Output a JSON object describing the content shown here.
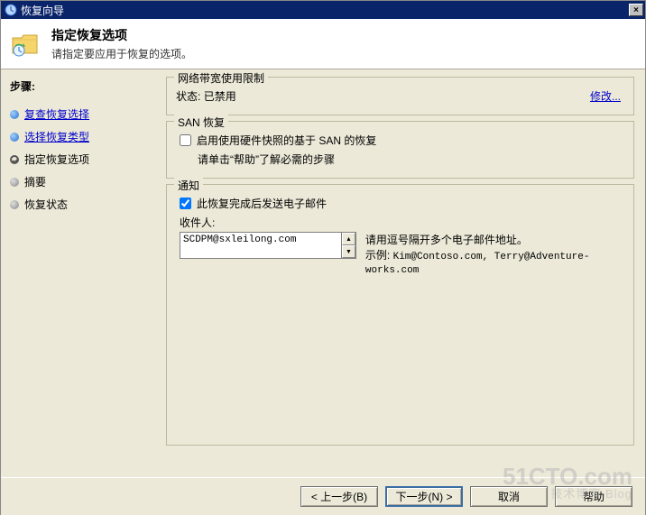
{
  "window": {
    "title": "恢复向导",
    "close": "×"
  },
  "header": {
    "title": "指定恢复选项",
    "subtitle": "请指定要应用于恢复的选项。"
  },
  "sidebar": {
    "label": "步骤:",
    "items": [
      {
        "label": "复查恢复选择",
        "state": "link"
      },
      {
        "label": "选择恢复类型",
        "state": "link"
      },
      {
        "label": "指定恢复选项",
        "state": "current"
      },
      {
        "label": "摘要",
        "state": "future"
      },
      {
        "label": "恢复状态",
        "state": "future"
      }
    ]
  },
  "groups": {
    "throttle": {
      "legend": "网络带宽使用限制",
      "status_label": "状态:",
      "status_value": "已禁用",
      "modify": "修改..."
    },
    "san": {
      "legend": "SAN 恢复",
      "checkbox_label": "启用使用硬件快照的基于 SAN 的恢复",
      "hint": "请单击“帮助”了解必需的步骤",
      "checked": false
    },
    "notify": {
      "legend": "通知",
      "checkbox_label": "此恢复完成后发送电子邮件",
      "checked": true,
      "recipients_label": "收件人:",
      "recipients_value": "SCDPM@sxleilong.com",
      "hint_line1": "请用逗号隔开多个电子邮件地址。",
      "hint_line2_prefix": "示例: ",
      "hint_line2_value": "Kim@Contoso.com, Terry@Adventure-works.com"
    }
  },
  "footer": {
    "back": "< 上一步(B)",
    "next": "下一步(N) >",
    "cancel": "取消",
    "help": "帮助"
  },
  "watermark": {
    "big": "51CTO.com",
    "small": "技术博客 Blog"
  }
}
